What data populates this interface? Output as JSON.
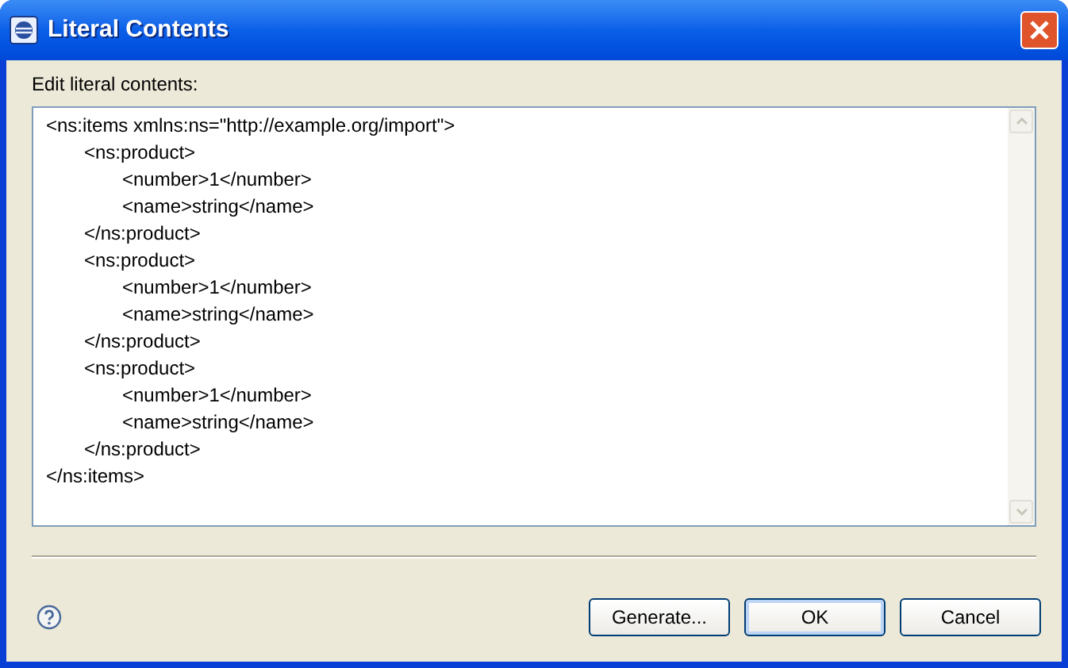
{
  "window": {
    "title": "Literal Contents"
  },
  "editor": {
    "label": "Edit literal contents:",
    "value": "<ns:items xmlns:ns=\"http://example.org/import\">\n\t<ns:product>\n\t\t<number>1</number>\n\t\t<name>string</name>\n\t</ns:product>\n\t<ns:product>\n\t\t<number>1</number>\n\t\t<name>string</name>\n\t</ns:product>\n\t<ns:product>\n\t\t<number>1</number>\n\t\t<name>string</name>\n\t</ns:product>\n</ns:items>"
  },
  "buttons": [
    {
      "label": "Generate...",
      "default": false
    },
    {
      "label": "OK",
      "default": true
    },
    {
      "label": "Cancel",
      "default": false
    }
  ]
}
